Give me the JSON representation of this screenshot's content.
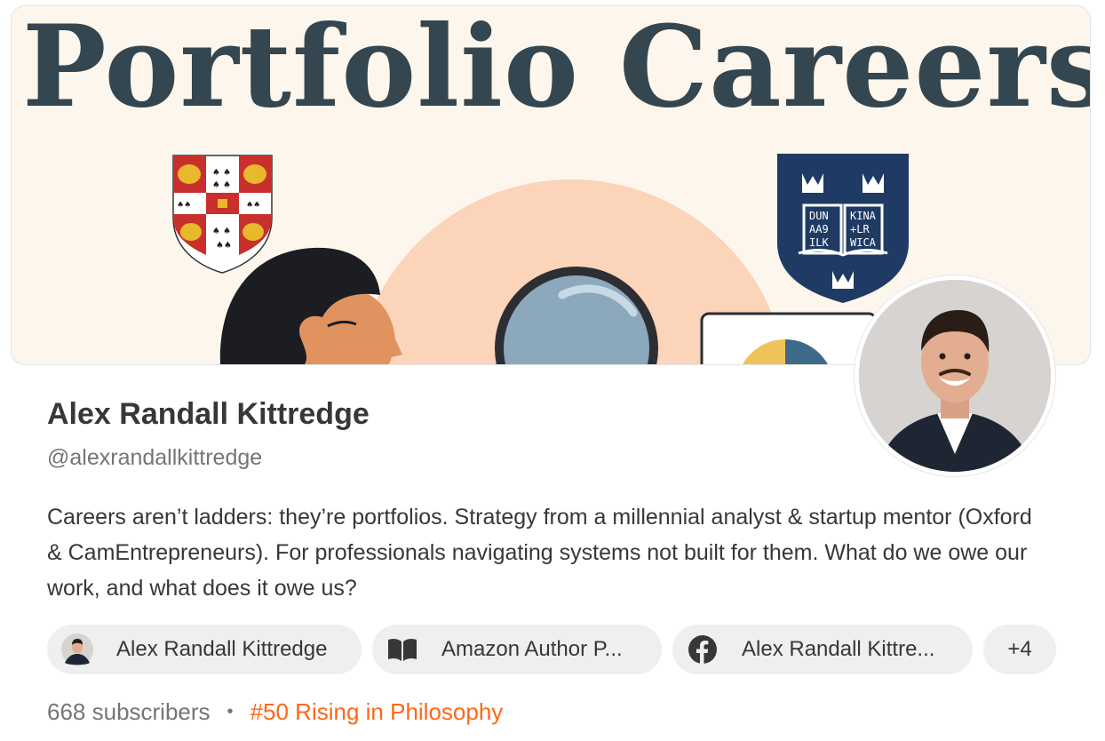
{
  "banner": {
    "title": "Portfolio Careers",
    "shield_text": [
      "DUN",
      "KINA",
      "AA9",
      "+LR",
      "ILK",
      "WICA"
    ],
    "colors": {
      "background": "#fdf6ec",
      "title": "#34464f",
      "circle": "#fbd4b9",
      "lens": "#8ba8bd",
      "oxford_shield": "#1f3b64",
      "cambridge_red": "#c9302c",
      "cambridge_gold": "#e8b82d"
    }
  },
  "profile": {
    "name": "Alex Randall Kittredge",
    "handle": "@alexrandallkittredge",
    "bio": "Careers aren’t ladders: they’re portfolios. Strategy from a millennial analyst & startup mentor (Oxford & CamEntrepreneurs). For professionals navigating systems not built for them. What do we owe our work, and what does it owe us?",
    "avatar_icon": "profile-photo"
  },
  "links": [
    {
      "label": "Alex Randall Kittredge",
      "icon": "avatar-thumbnail-icon"
    },
    {
      "label": "Amazon Author P...",
      "icon": "book-icon"
    },
    {
      "label": "Alex Randall Kittre...",
      "icon": "facebook-icon"
    },
    {
      "label": "+4"
    }
  ],
  "stats": {
    "subscribers": "668 subscribers",
    "separator": "•",
    "rank": "#50 Rising in Philosophy",
    "rank_color": "#ff6719"
  }
}
